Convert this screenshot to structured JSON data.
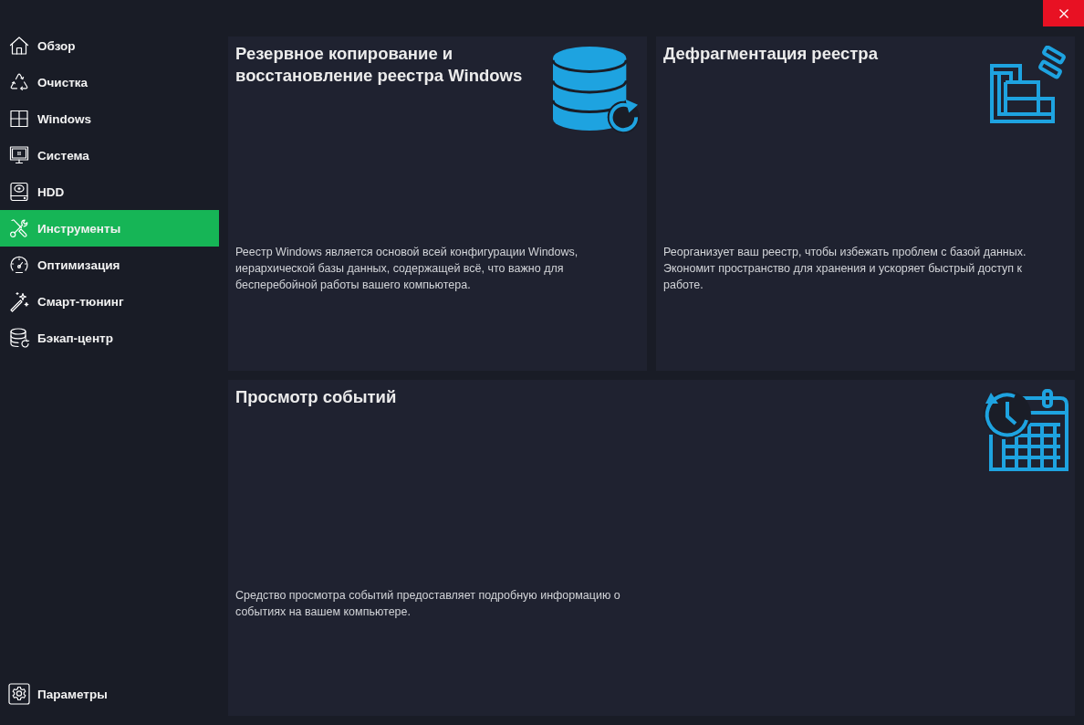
{
  "sidebar": {
    "items": [
      {
        "label": "Обзор",
        "selected": false
      },
      {
        "label": "Очистка",
        "selected": false
      },
      {
        "label": "Windows",
        "selected": false
      },
      {
        "label": "Система",
        "selected": false
      },
      {
        "label": "HDD",
        "selected": false
      },
      {
        "label": "Инструменты",
        "selected": true
      },
      {
        "label": "Оптимизация",
        "selected": false
      },
      {
        "label": "Смарт-тюнинг",
        "selected": false
      },
      {
        "label": "Бэкап-центр",
        "selected": false
      }
    ],
    "footer": {
      "label": "Параметры"
    }
  },
  "cards": [
    {
      "title": "Резервное копирование и восстановление реестра Windows",
      "description": "Реестр Windows является основой всей конфигурации Windows, иерархической базы данных, содержащей всё, что важно для бесперебойной работы вашего компьютера."
    },
    {
      "title": "Дефрагментация реестра",
      "description": "Реорганизует ваш реестр, чтобы избежать проблем с базой данных. Экономит пространство для хранения и ускоряет быстрый доступ к работе."
    },
    {
      "title": "Просмотр событий",
      "description": "Средство просмотра событий предоставляет подробную информацию о событиях на вашем компьютере."
    }
  ]
}
